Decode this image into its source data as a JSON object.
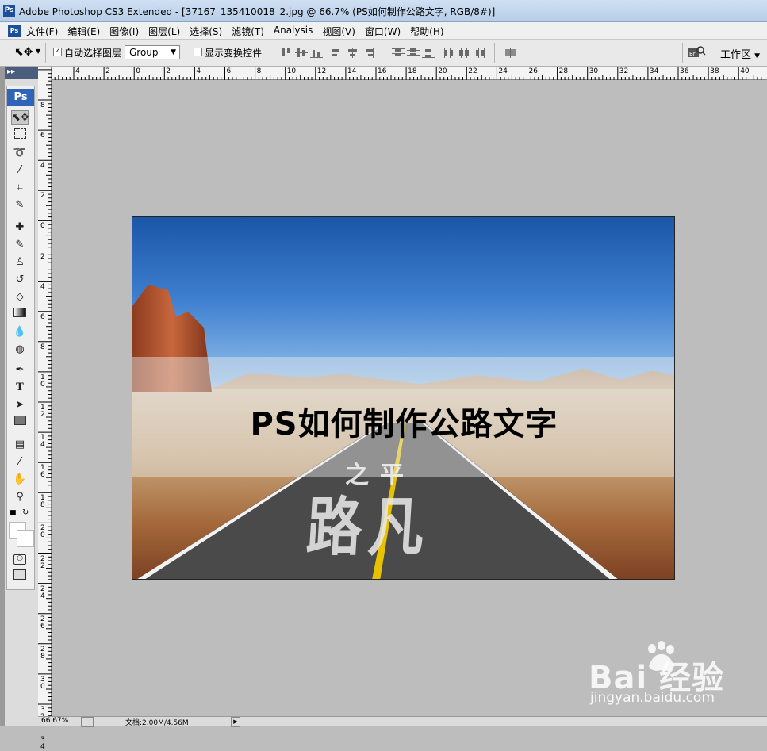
{
  "window": {
    "title": "Adobe Photoshop CS3 Extended - [37167_135410018_2.jpg @ 66.7% (PS如何制作公路文字, RGB/8#)]",
    "app_icon_label": "Ps"
  },
  "menu": {
    "items": [
      "文件(F)",
      "编辑(E)",
      "图像(I)",
      "图层(L)",
      "选择(S)",
      "滤镜(T)",
      "Analysis",
      "视图(V)",
      "窗口(W)",
      "帮助(H)"
    ]
  },
  "options": {
    "auto_select_label": "自动选择图层",
    "auto_select_checked": true,
    "auto_select_value": "Group",
    "show_transform_label": "显示变换控件",
    "show_transform_checked": false,
    "workspace_label": "工作区"
  },
  "toolbox": {
    "logo": "Ps",
    "tools": [
      "move-tool",
      "marquee-tool",
      "lasso-tool",
      "magic-wand-tool",
      "crop-tool",
      "slice-tool",
      "healing-brush-tool",
      "brush-tool",
      "clone-stamp-tool",
      "history-brush-tool",
      "eraser-tool",
      "gradient-tool",
      "blur-tool",
      "dodge-tool",
      "pen-tool",
      "type-tool",
      "path-selection-tool",
      "shape-tool",
      "notes-tool",
      "eyedropper-tool",
      "hand-tool",
      "zoom-tool"
    ]
  },
  "rulers": {
    "horizontal_labels": [
      "4",
      "2",
      "0",
      "2",
      "4",
      "6",
      "8",
      "10",
      "12",
      "14",
      "16",
      "18",
      "20",
      "22",
      "24",
      "26",
      "28",
      "30",
      "32",
      "34",
      "36",
      "38",
      "40"
    ],
    "vertical_labels": [
      "8",
      "6",
      "4",
      "2",
      "0",
      "2",
      "4",
      "6",
      "8",
      "1 0",
      "1 2",
      "1 4",
      "1 6",
      "1 8",
      "2 0",
      "2 2",
      "2 4",
      "2 6",
      "2 8",
      "3 0",
      "3 2",
      "3 4"
    ]
  },
  "image": {
    "headline": "PS如何制作公路文字",
    "road_text_small": "之平",
    "road_text_large": "路凡"
  },
  "status": {
    "zoom": "66.67%",
    "doc": "文档:2.00M/4.56M"
  },
  "watermark": {
    "logo": "Bai 经验",
    "url": "jingyan.baidu.com"
  }
}
